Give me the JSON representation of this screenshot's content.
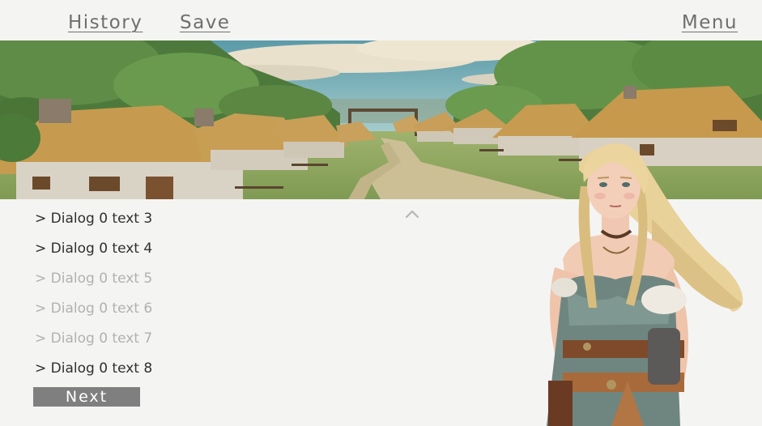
{
  "nav": {
    "history_label": "History",
    "save_label": "Save",
    "menu_label": "Menu"
  },
  "dialog": {
    "lines": [
      {
        "text": "> Dialog 0 text 3",
        "state": "current"
      },
      {
        "text": "> Dialog 0 text 4",
        "state": "current"
      },
      {
        "text": "> Dialog 0 text 5",
        "state": "faded"
      },
      {
        "text": "> Dialog 0 text 6",
        "state": "faded"
      },
      {
        "text": "> Dialog 0 text 7",
        "state": "faded"
      },
      {
        "text": "> Dialog 0 text 8",
        "state": "current"
      }
    ],
    "next_label": "Next"
  },
  "icons": {
    "scroll_up": "chevron-up-icon"
  },
  "colors": {
    "background": "#f4f4f3",
    "nav_text": "#6f6f6f",
    "dialog_current": "#2f2f2f",
    "dialog_faded": "#b1b1b1",
    "next_button": "#7f7f7f"
  }
}
